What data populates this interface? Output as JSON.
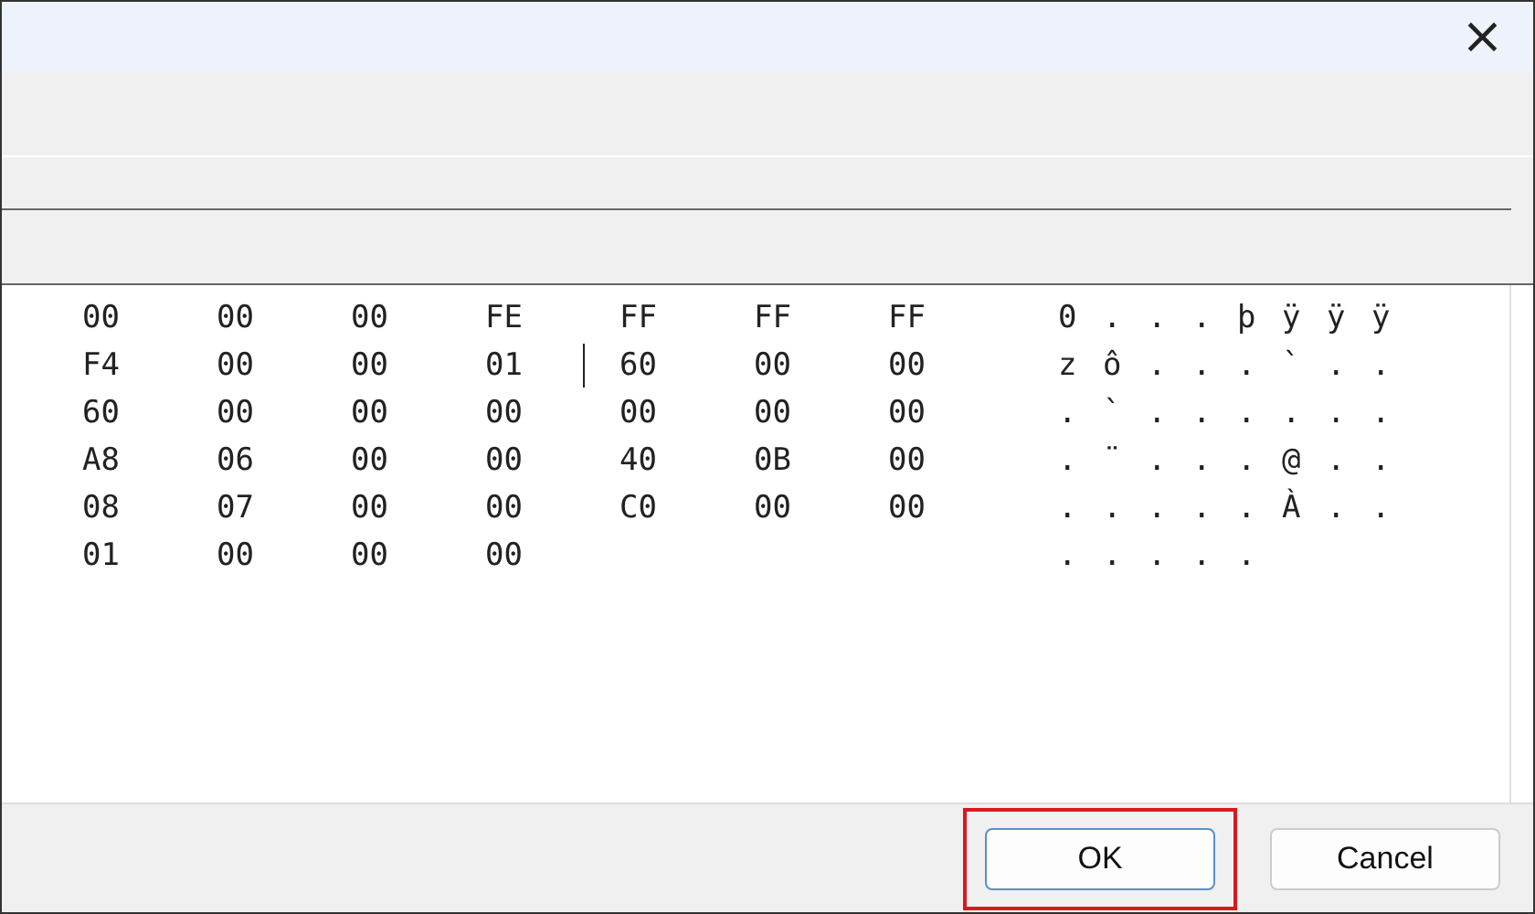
{
  "window": {
    "close": "×"
  },
  "rows": [
    {
      "bytes": [
        {
          "hex": "00"
        },
        {
          "hex": "00"
        },
        {
          "hex": "00"
        },
        {
          "hex": "FE"
        },
        {
          "hex": "FF"
        },
        {
          "hex": "FF"
        },
        {
          "hex": "FF"
        }
      ],
      "chars": [
        "0",
        ".",
        ".",
        ".",
        "þ",
        "ÿ",
        "ÿ",
        "ÿ"
      ]
    },
    {
      "bytes": [
        {
          "hex": "F4"
        },
        {
          "hex": "00"
        },
        {
          "hex": "00"
        },
        {
          "hex": "01"
        },
        {
          "hex": "60",
          "caret": true
        },
        {
          "hex": "00"
        },
        {
          "hex": "00"
        }
      ],
      "chars": [
        "z",
        "ô",
        ".",
        ".",
        ".",
        "`",
        ".",
        "."
      ]
    },
    {
      "bytes": [
        {
          "hex": "60"
        },
        {
          "hex": "00"
        },
        {
          "hex": "00"
        },
        {
          "hex": "00"
        },
        {
          "hex": "00"
        },
        {
          "hex": "00"
        },
        {
          "hex": "00"
        }
      ],
      "chars": [
        ".",
        "`",
        ".",
        ".",
        ".",
        ".",
        ".",
        "."
      ]
    },
    {
      "bytes": [
        {
          "hex": "A8"
        },
        {
          "hex": "06"
        },
        {
          "hex": "00"
        },
        {
          "hex": "00"
        },
        {
          "hex": "40"
        },
        {
          "hex": "0B"
        },
        {
          "hex": "00"
        }
      ],
      "chars": [
        ".",
        "¨",
        ".",
        ".",
        ".",
        "@",
        ".",
        "."
      ]
    },
    {
      "bytes": [
        {
          "hex": "08"
        },
        {
          "hex": "07"
        },
        {
          "hex": "00"
        },
        {
          "hex": "00"
        },
        {
          "hex": "C0"
        },
        {
          "hex": "00"
        },
        {
          "hex": "00"
        }
      ],
      "chars": [
        ".",
        ".",
        ".",
        ".",
        ".",
        "À",
        ".",
        "."
      ]
    },
    {
      "bytes": [
        {
          "hex": "01"
        },
        {
          "hex": "00"
        },
        {
          "hex": "00"
        },
        {
          "hex": "00"
        }
      ],
      "chars": [
        ".",
        ".",
        ".",
        ".",
        "."
      ]
    }
  ],
  "buttons": [
    {
      "label": "OK",
      "highlighted": true
    },
    {
      "label": "Cancel",
      "highlighted": false
    }
  ]
}
